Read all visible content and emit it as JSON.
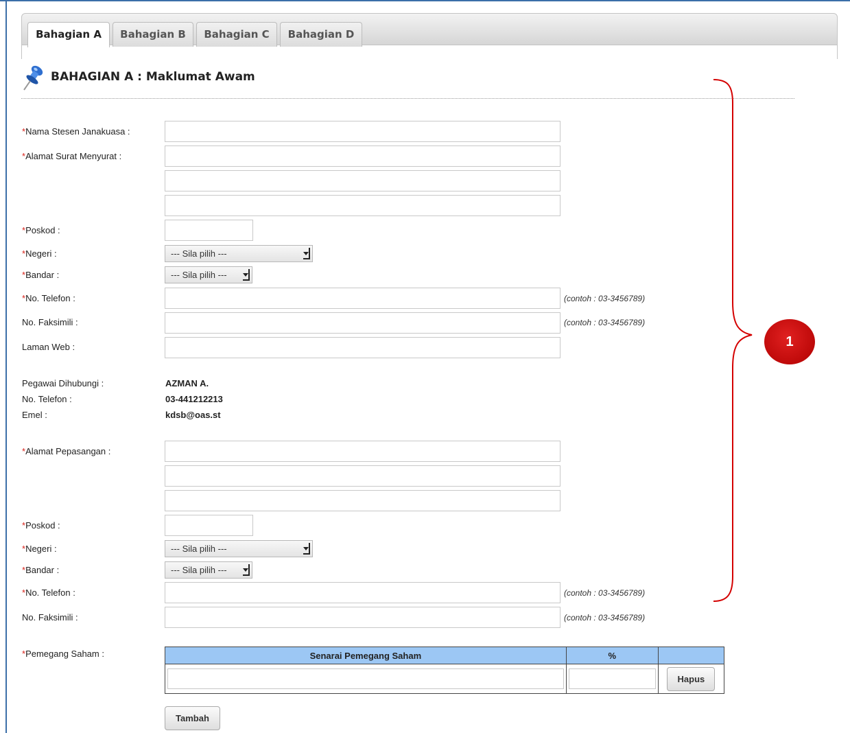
{
  "tabs": [
    {
      "label": "Bahagian A"
    },
    {
      "label": "Bahagian B"
    },
    {
      "label": "Bahagian C"
    },
    {
      "label": "Bahagian D"
    }
  ],
  "section_title": "BAHAGIAN A : Maklumat Awam",
  "required_marker": "*",
  "form": {
    "nama_stesen_label": "Nama Stesen Janakuasa :",
    "alamat_surat_label": "Alamat Surat Menyurat :",
    "poskod_label": "Poskod :",
    "negeri_label": "Negeri :",
    "bandar_label": "Bandar :",
    "telefon_label": "No. Telefon :",
    "faksimili_label": "No. Faksimili :",
    "laman_web_label": "Laman Web :",
    "select_placeholder": "--- Sila pilih ---",
    "phone_hint": "(contoh : 03-3456789)"
  },
  "contact": {
    "pegawai_label": "Pegawai Dihubungi :",
    "pegawai_value": "AZMAN A.",
    "telefon_label": "No. Telefon :",
    "telefon_value": "03-441212213",
    "emel_label": "Emel :",
    "emel_value": "kdsb@oas.st"
  },
  "installation": {
    "alamat_pepasangan_label": "Alamat Pepasangan :"
  },
  "shareholders": {
    "label": "Pemegang Saham :",
    "col_name": "Senarai Pemegang Saham",
    "col_percent": "%",
    "delete_button": "Hapus",
    "add_button": "Tambah"
  },
  "callout_number": "1",
  "colors": {
    "required": "#d9251d",
    "table_header": "#9cc7f4",
    "callout": "#c00000",
    "brace": "#d40000"
  }
}
